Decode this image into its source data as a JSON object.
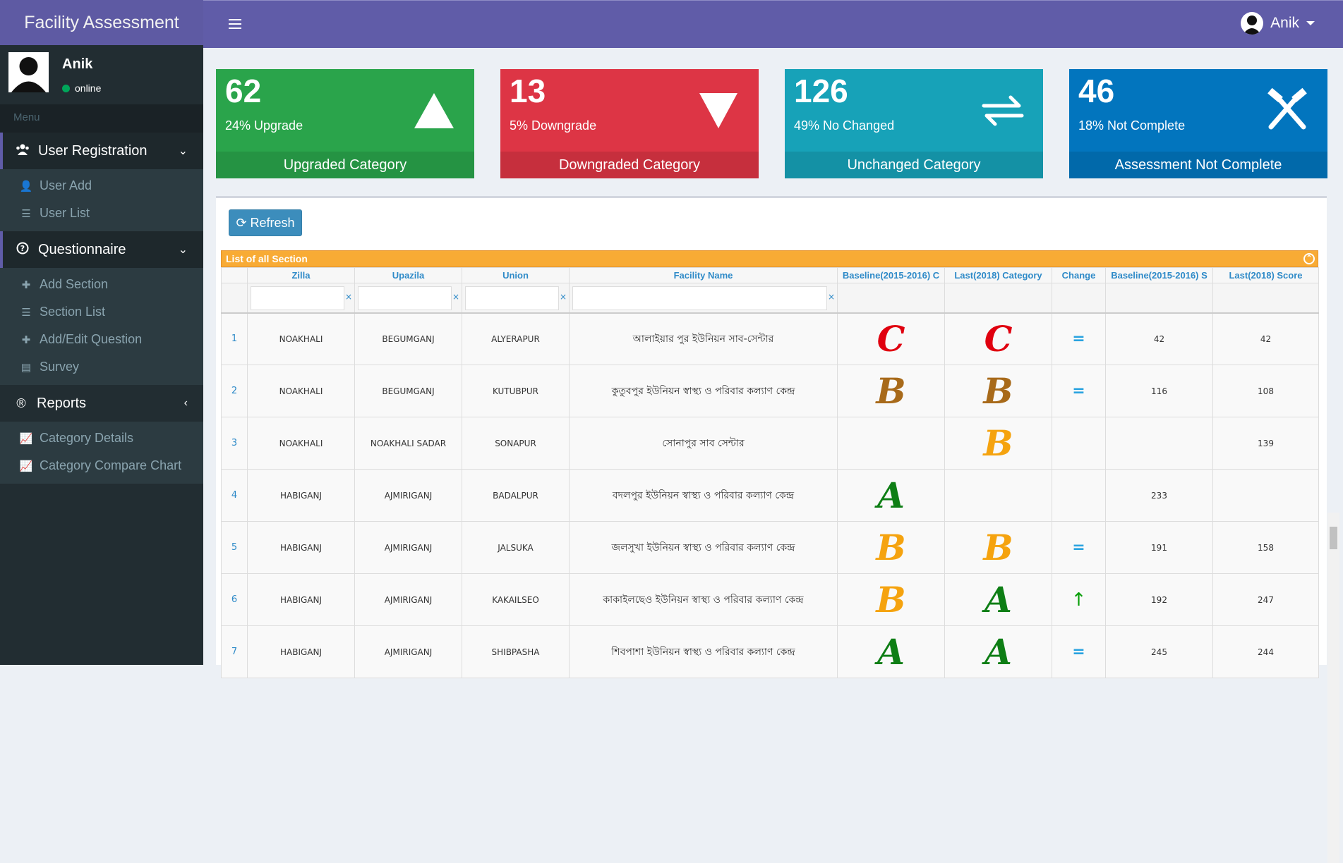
{
  "app": {
    "brand": "Facility Assessment"
  },
  "header": {
    "user_name": "Anik"
  },
  "sidebar": {
    "user_name": "Anik",
    "status": "online",
    "menu_header": "Menu",
    "sections": [
      {
        "label": "User Registration",
        "items": [
          "User Add",
          "User List"
        ]
      },
      {
        "label": "Questionnaire",
        "items": [
          "Add Section",
          "Section List",
          "Add/Edit Question",
          "Survey"
        ]
      },
      {
        "label": "Reports",
        "items": [
          "Category Details",
          "Category Compare Chart"
        ]
      }
    ]
  },
  "stats": [
    {
      "number": "62",
      "text": "24% Upgrade",
      "footer": "Upgraded Category",
      "icon": "triangle-up-icon",
      "color": "#2aa44b"
    },
    {
      "number": "13",
      "text": "5% Downgrade",
      "footer": "Downgraded Category",
      "icon": "triangle-down-icon",
      "color": "#dd3545"
    },
    {
      "number": "126",
      "text": "49% No Changed",
      "footer": "Unchanged Category",
      "icon": "exchange-icon",
      "color": "#17a2b8"
    },
    {
      "number": "46",
      "text": "18% Not Complete",
      "footer": "Assessment Not Complete",
      "icon": "hammers-icon",
      "color": "#0275be"
    }
  ],
  "toolbar": {
    "refresh_label": "Refresh"
  },
  "grid": {
    "caption": "List of all Section",
    "columns": [
      "Zilla",
      "Upazila",
      "Union",
      "Facility Name",
      "Baseline(2015-2016) C",
      "Last(2018) Category",
      "Change",
      "Baseline(2015-2016) S",
      "Last(2018) Score"
    ],
    "rows": [
      {
        "n": "1",
        "zilla": "NOAKHALI",
        "upazila": "BEGUMGANJ",
        "union": "ALYERAPUR",
        "facility": "আলাইয়ার পুর ইউনিয়ন সাব-সেন্টার",
        "base_cat": "C",
        "last_cat": "C",
        "change": "=",
        "base_score": "42",
        "last_score": "42"
      },
      {
        "n": "2",
        "zilla": "NOAKHALI",
        "upazila": "BEGUMGANJ",
        "union": "KUTUBPUR",
        "facility": "কুতুবপুর ইউনিয়ন স্বাস্থ্য ও পরিবার কল্যাণ কেন্দ্র",
        "base_cat": "B",
        "last_cat": "B",
        "change": "=",
        "base_score": "116",
        "last_score": "108"
      },
      {
        "n": "3",
        "zilla": "NOAKHALI",
        "upazila": "NOAKHALI SADAR",
        "union": "SONAPUR",
        "facility": "সোনাপুর সাব সেন্টার",
        "base_cat": "",
        "last_cat": "B",
        "change": "",
        "base_score": "",
        "last_score": "139"
      },
      {
        "n": "4",
        "zilla": "HABIGANJ",
        "upazila": "AJMIRIGANJ",
        "union": "BADALPUR",
        "facility": "বদলপুর ইউনিয়ন স্বাস্থ্য ও পরিবার কল্যাণ কেন্দ্র",
        "base_cat": "A",
        "last_cat": "",
        "change": "",
        "base_score": "233",
        "last_score": ""
      },
      {
        "n": "5",
        "zilla": "HABIGANJ",
        "upazila": "AJMIRIGANJ",
        "union": "JALSUKA",
        "facility": "জলসুখা ইউনিয়ন স্বাস্থ্য ও পরিবার কল্যাণ কেন্দ্র",
        "base_cat": "B",
        "last_cat": "B",
        "change": "=",
        "base_score": "191",
        "last_score": "158"
      },
      {
        "n": "6",
        "zilla": "HABIGANJ",
        "upazila": "AJMIRIGANJ",
        "union": "KAKAILSEO",
        "facility": "কাকাইলছেও ইউনিয়ন স্বাস্থ্য ও পরিবার কল্যাণ কেন্দ্র",
        "base_cat": "B",
        "last_cat": "A",
        "change": "↑",
        "base_score": "192",
        "last_score": "247"
      },
      {
        "n": "7",
        "zilla": "HABIGANJ",
        "upazila": "AJMIRIGANJ",
        "union": "SHIBPASHA",
        "facility": "শিবপাশা ইউনিয়ন স্বাস্থ্য ও পরিবার কল্যাণ কেন্দ্র",
        "base_cat": "A",
        "last_cat": "A",
        "change": "=",
        "base_score": "245",
        "last_score": "244"
      }
    ]
  }
}
